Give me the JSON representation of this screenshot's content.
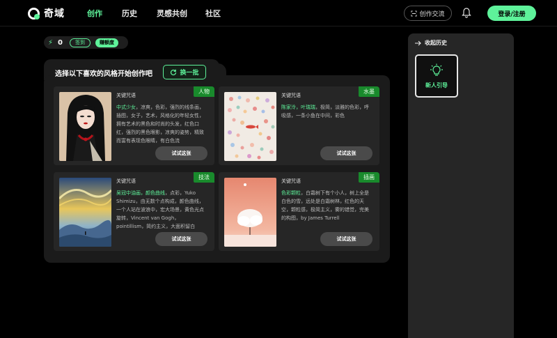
{
  "app": {
    "logo_text": "奇域"
  },
  "nav": {
    "items": [
      {
        "label": "创作",
        "active": true
      },
      {
        "label": "历史",
        "active": false
      },
      {
        "label": "灵感共创",
        "active": false
      },
      {
        "label": "社区",
        "active": false
      }
    ],
    "exchange_label": "创作交流",
    "login_label": "登录/注册"
  },
  "points": {
    "count": "0",
    "sign_label": "签到",
    "inspire_label": "赚额度"
  },
  "panel": {
    "title": "选择以下喜欢的风格开始创作吧",
    "refresh_label": "换一批",
    "cards": [
      {
        "tag": "人物",
        "keyword_label": "关键咒语",
        "highlight": "中式少女",
        "text": "，凉爽，色彩，强烈的线条画，插图，女子，艺术，风格化的年轻女性，拥有艺术的黑色和时尚的头发，红色口红，强烈的黑色眼影，凉爽的姿势，精致而富有表现色眼睛，有白色流",
        "try_label": "试试这张"
      },
      {
        "tag": "水墨",
        "keyword_label": "关键咒语",
        "highlight": "陈家泠，叶瑞瑞",
        "text": "，极简，淡雅的色彩，呼吸感，一条小鱼在中间，彩色",
        "try_label": "试试这张"
      },
      {
        "tag": "技法",
        "keyword_label": "关键咒语",
        "highlight": "吴冠中油画，颜色曲线",
        "text": "，点彩，Yuko Shimizu，由无数个点构成，颜色曲线，一个人站在波浪中，宏大场景，黄色光点旋转，Vincent van Gogh，pointillism，简约主义，大面积留白",
        "try_label": "试试这张"
      },
      {
        "tag": "插画",
        "keyword_label": "关键咒语",
        "highlight": "色彩颗粒",
        "text": "，白霜树下有个小人，树上全是白色的雪，远处是白霜树林，红色的天空，颗粒感，极简主义，雾的错觉，完美的构图，by James Turrell",
        "try_label": "试试这张"
      }
    ]
  },
  "sidebar": {
    "collapse_label": "收起历史",
    "guide_label": "新人引导"
  },
  "colors": {
    "accent": "#5ef29a",
    "tag_bg": "#198a2c",
    "panel_bg": "#1b1b1b",
    "card_bg": "#262626"
  }
}
